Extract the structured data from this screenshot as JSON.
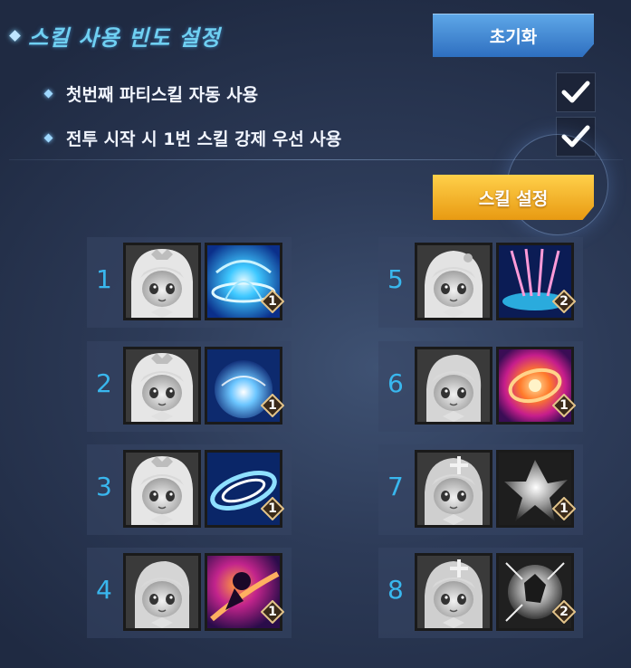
{
  "header": {
    "title": "스킬 사용 빈도 설정",
    "reset_label": "초기화"
  },
  "options": [
    {
      "label": "첫번째 파티스킬 자동 사용",
      "checked": true
    },
    {
      "label": "전투 시작 시 1번 스킬 강제 우선 사용",
      "checked": true
    }
  ],
  "skill_setting_label": "스킬 설정",
  "slots": [
    {
      "number": "1",
      "level": "1",
      "portrait": "girl-hood-portrait",
      "icon": "blue-vortex-skill-icon"
    },
    {
      "number": "2",
      "level": "1",
      "portrait": "girl-hood-portrait",
      "icon": "blue-orb-skill-icon"
    },
    {
      "number": "3",
      "level": "1",
      "portrait": "girl-hood-portrait",
      "icon": "blue-swirl-skill-icon"
    },
    {
      "number": "4",
      "level": "1",
      "portrait": "boy-portrait",
      "icon": "purple-slash-skill-icon"
    },
    {
      "number": "5",
      "level": "2",
      "portrait": "girl-bow-portrait",
      "icon": "chain-burst-skill-icon"
    },
    {
      "number": "6",
      "level": "1",
      "portrait": "boy-portrait",
      "icon": "orange-spiral-skill-icon"
    },
    {
      "number": "7",
      "level": "1",
      "portrait": "girl-cross-portrait",
      "icon": "white-shatter-skill-icon"
    },
    {
      "number": "8",
      "level": "2",
      "portrait": "girl-cross-portrait",
      "icon": "white-explosion-skill-icon"
    }
  ],
  "colors": {
    "title": "#6fd0f2",
    "slot_number": "#39b7ee",
    "reset_button": "#3f86d4",
    "skill_button": "#f5b42c",
    "check": "#ffffff"
  }
}
